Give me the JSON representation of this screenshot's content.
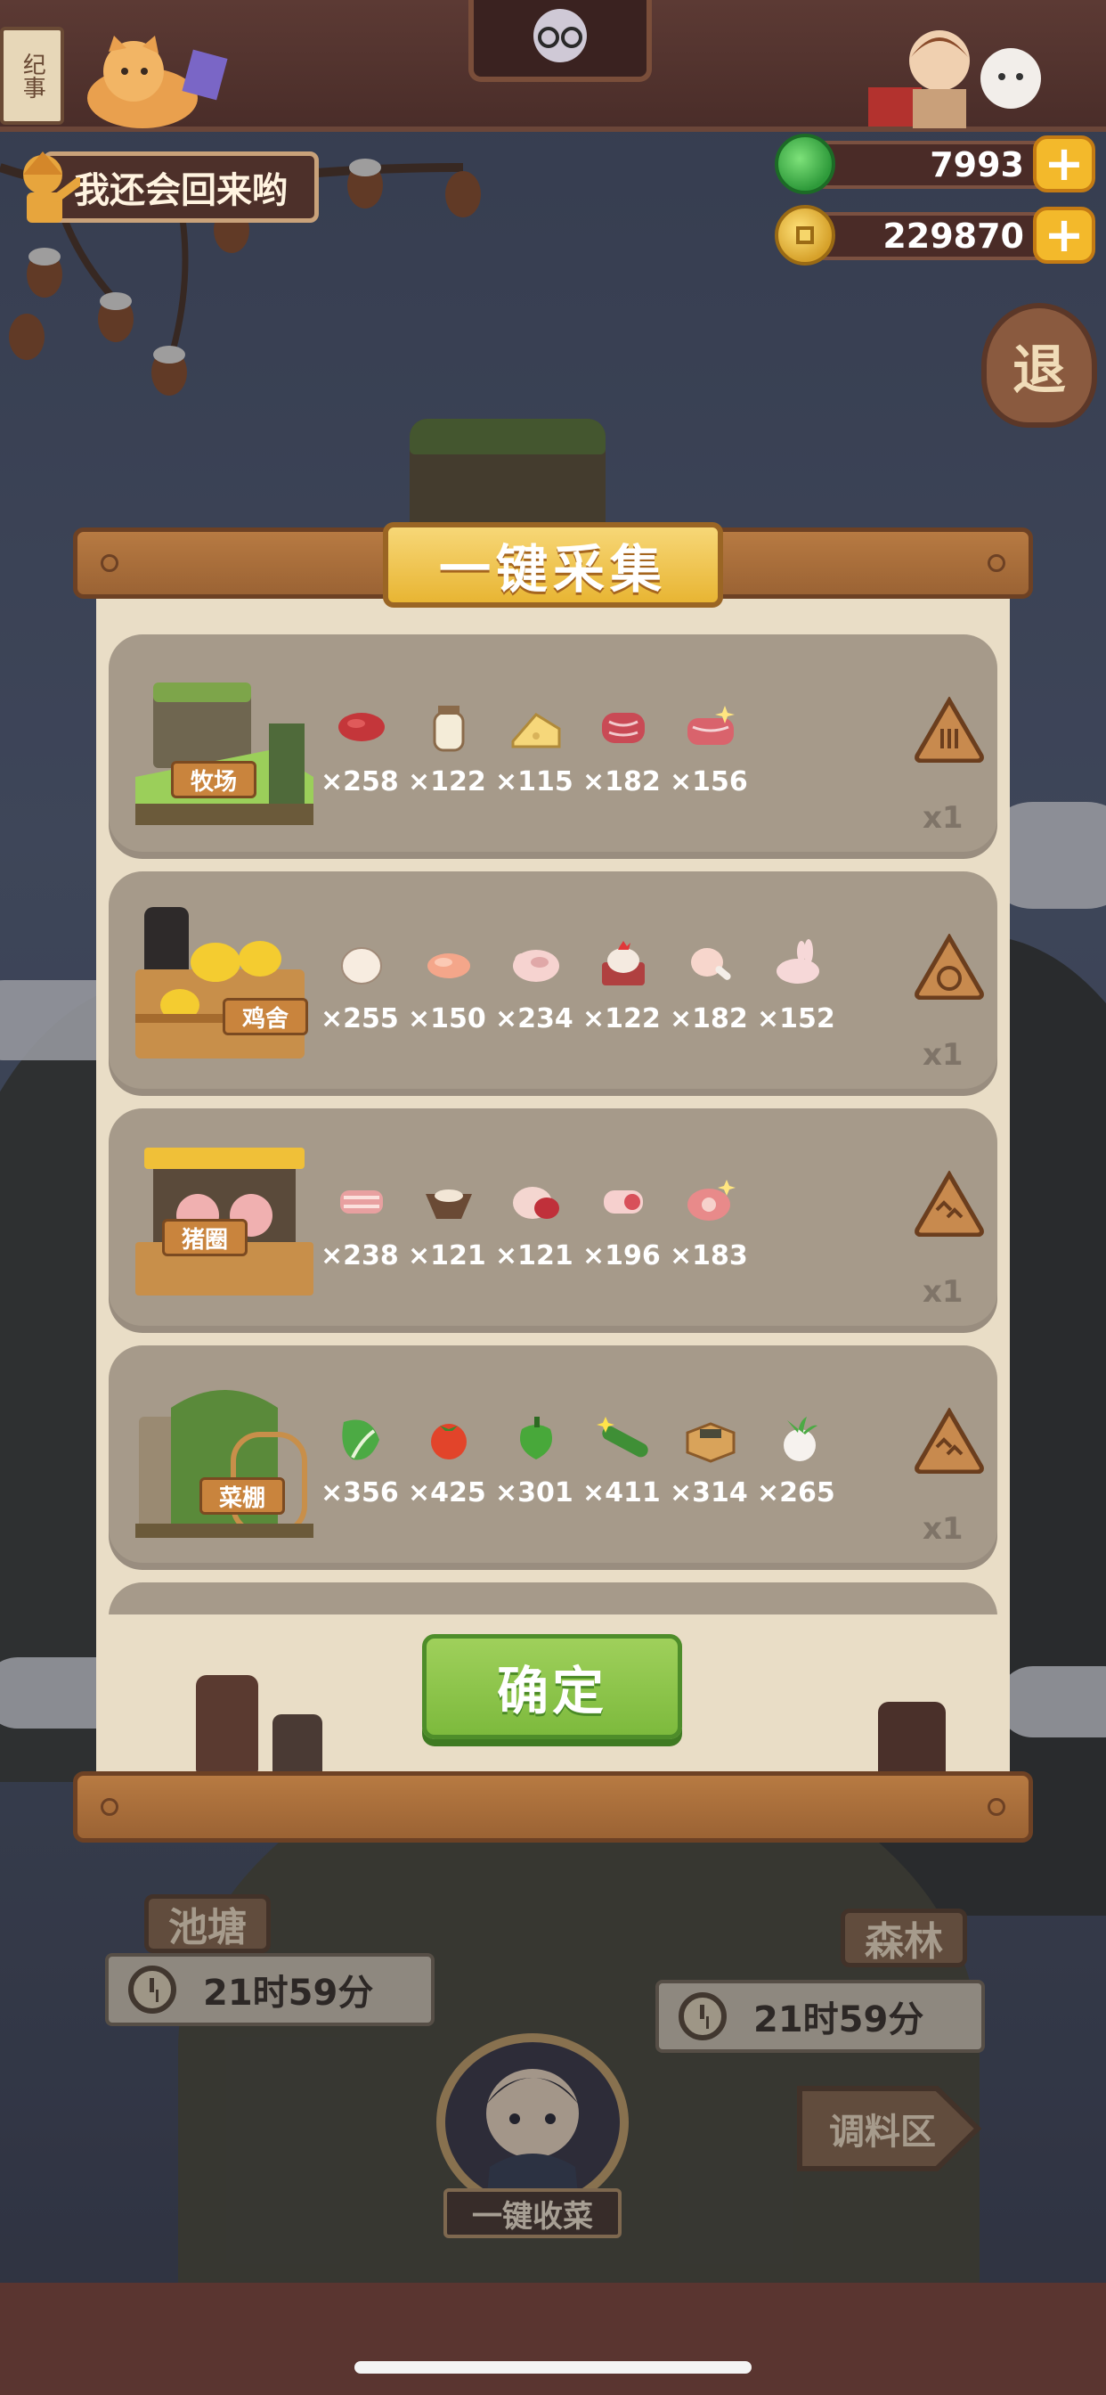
{
  "top": {
    "book_sign": "纪事",
    "banner_text": "我还会回来哟"
  },
  "currency": {
    "jade": {
      "amount": "7993",
      "icon": "jade-coin-icon",
      "plus": "+"
    },
    "coins": {
      "amount": "229870",
      "icon": "copper-coin-icon",
      "plus": "+"
    }
  },
  "exit_label": "退",
  "modal": {
    "title": "一键采集",
    "confirm_label": "确定",
    "rows": [
      {
        "building": "牧场",
        "items": [
          {
            "icon": "beef-icon",
            "qty": "×258"
          },
          {
            "icon": "milk-jar-icon",
            "qty": "×122"
          },
          {
            "icon": "cheese-icon",
            "qty": "×115"
          },
          {
            "icon": "steak-icon",
            "qty": "×182"
          },
          {
            "icon": "premium-steak-icon",
            "qty": "×156"
          }
        ],
        "badge": "upgrade-badge-icon",
        "count": "x1"
      },
      {
        "building": "鸡舍",
        "items": [
          {
            "icon": "egg-icon",
            "qty": "×255"
          },
          {
            "icon": "chicken-breast-icon",
            "qty": "×150"
          },
          {
            "icon": "whole-chicken-icon",
            "qty": "×234"
          },
          {
            "icon": "rooster-icon",
            "qty": "×122"
          },
          {
            "icon": "drumstick-icon",
            "qty": "×182"
          },
          {
            "icon": "rabbit-icon",
            "qty": "×152"
          }
        ],
        "badge": "upgrade-badge-icon",
        "count": "x1"
      },
      {
        "building": "猪圈",
        "items": [
          {
            "icon": "pork-belly-icon",
            "qty": "×238"
          },
          {
            "icon": "pork-stew-icon",
            "qty": "×121"
          },
          {
            "icon": "pork-chop-icon",
            "qty": "×121"
          },
          {
            "icon": "bacon-roll-icon",
            "qty": "×196"
          },
          {
            "icon": "ham-icon",
            "qty": "×183"
          }
        ],
        "badge": "upgrade-badge-icon",
        "count": "x1"
      },
      {
        "building": "菜棚",
        "items": [
          {
            "icon": "cabbage-icon",
            "qty": "×356"
          },
          {
            "icon": "tomato-icon",
            "qty": "×425"
          },
          {
            "icon": "pepper-icon",
            "qty": "×301"
          },
          {
            "icon": "cucumber-icon",
            "qty": "×411"
          },
          {
            "icon": "tofu-box-icon",
            "qty": "×314"
          },
          {
            "icon": "radish-icon",
            "qty": "×265"
          }
        ],
        "badge": "upgrade-badge-icon",
        "count": "x1"
      }
    ]
  },
  "scene": {
    "pond_label": "池塘",
    "pond_timer": "21时59分",
    "forest_label": "森林",
    "forest_timer": "21时59分",
    "seasoning_label": "调料区",
    "harvest_label": "一键收菜"
  },
  "colors": {
    "confirm_green": "#8cc54a",
    "title_gold": "#f0c445",
    "row_bg": "#a69a8a",
    "paper": "#e9ddc6"
  }
}
